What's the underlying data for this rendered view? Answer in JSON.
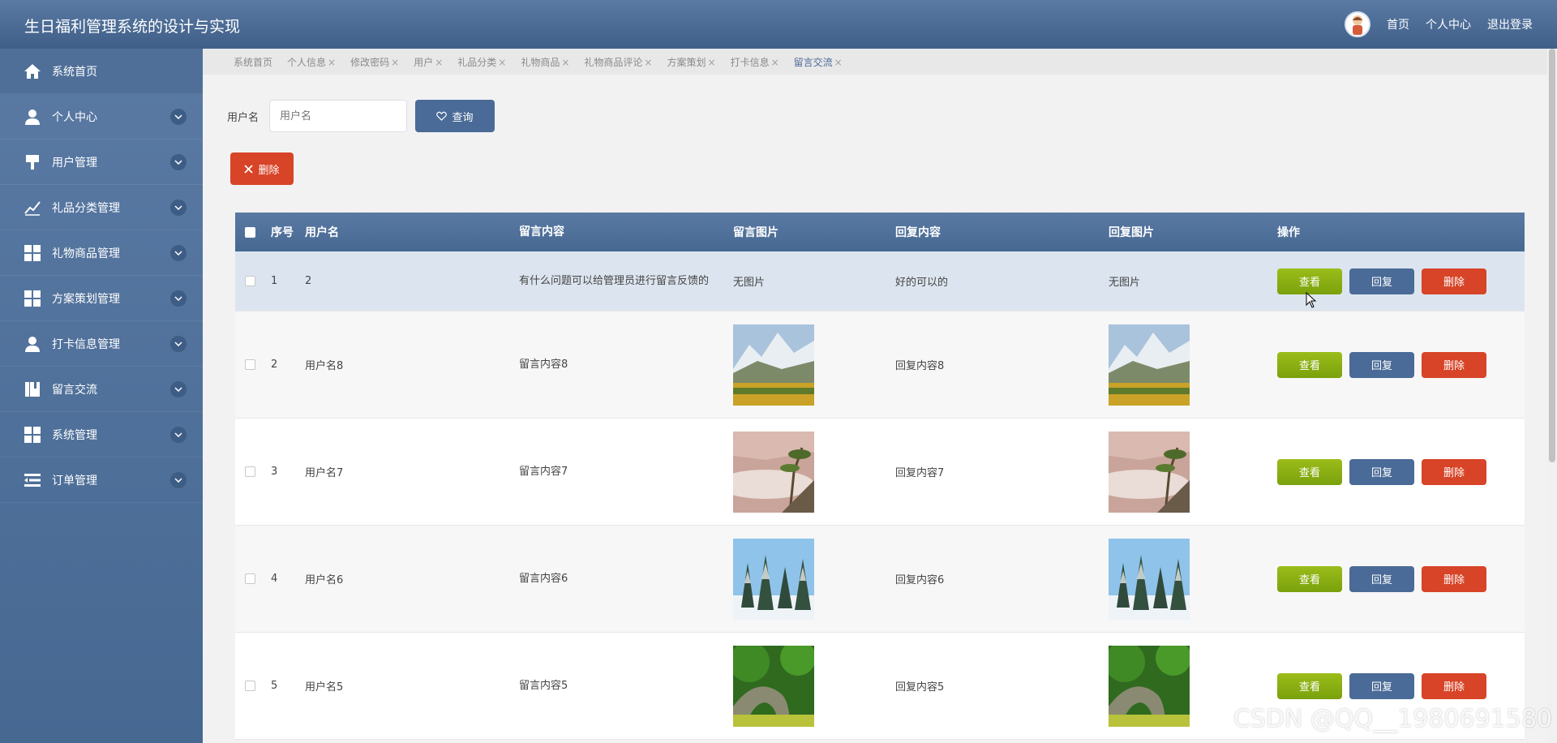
{
  "header": {
    "title": "生日福利管理系统的设计与实现",
    "links": [
      "首页",
      "个人中心",
      "退出登录"
    ]
  },
  "sidebar": {
    "items": [
      {
        "label": "系统首页",
        "icon": "home-icon"
      },
      {
        "label": "个人中心",
        "icon": "user-icon"
      },
      {
        "label": "用户管理",
        "icon": "brush-icon"
      },
      {
        "label": "礼品分类管理",
        "icon": "chart-line-icon"
      },
      {
        "label": "礼物商品管理",
        "icon": "grid-icon"
      },
      {
        "label": "方案策划管理",
        "icon": "grid-icon"
      },
      {
        "label": "打卡信息管理",
        "icon": "user-icon"
      },
      {
        "label": "留言交流",
        "icon": "book-icon"
      },
      {
        "label": "系统管理",
        "icon": "grid-icon"
      },
      {
        "label": "订单管理",
        "icon": "list-icon"
      }
    ]
  },
  "tabs": [
    {
      "label": "系统首页",
      "closable": false
    },
    {
      "label": "个人信息",
      "closable": true
    },
    {
      "label": "修改密码",
      "closable": true
    },
    {
      "label": "用户",
      "closable": true
    },
    {
      "label": "礼品分类",
      "closable": true
    },
    {
      "label": "礼物商品",
      "closable": true
    },
    {
      "label": "礼物商品评论",
      "closable": true
    },
    {
      "label": "方案策划",
      "closable": true
    },
    {
      "label": "打卡信息",
      "closable": true
    },
    {
      "label": "留言交流",
      "closable": true,
      "active": true
    }
  ],
  "search": {
    "label": "用户名",
    "placeholder": "用户名",
    "query_label": "查询",
    "delete_label": "删除"
  },
  "table": {
    "headers": [
      "序号",
      "用户名",
      "留言内容",
      "留言图片",
      "回复内容",
      "回复图片",
      "操作"
    ],
    "ops": {
      "view": "查看",
      "reply": "回复",
      "delete": "删除"
    },
    "rows": [
      {
        "no": "1",
        "user": "2",
        "message": "有什么问题可以给管理员进行留言反馈的",
        "msg_img": "无图片",
        "reply": "好的可以的",
        "reply_img": "无图片",
        "scene": null
      },
      {
        "no": "2",
        "user": "用户名8",
        "message": "留言内容8",
        "reply": "回复内容8",
        "scene": "mountain-autumn"
      },
      {
        "no": "3",
        "user": "用户名7",
        "message": "留言内容7",
        "reply": "回复内容7",
        "scene": "pine-fog"
      },
      {
        "no": "4",
        "user": "用户名6",
        "message": "留言内容6",
        "reply": "回复内容6",
        "scene": "snow-forest"
      },
      {
        "no": "5",
        "user": "用户名5",
        "message": "留言内容5",
        "reply": "回复内容5",
        "scene": "stone-bridge"
      }
    ]
  },
  "watermark": "CSDN @QQ__1980691580",
  "colors": {
    "primary": "#4a6b97",
    "danger": "#d74427",
    "success": "#8bb015"
  }
}
